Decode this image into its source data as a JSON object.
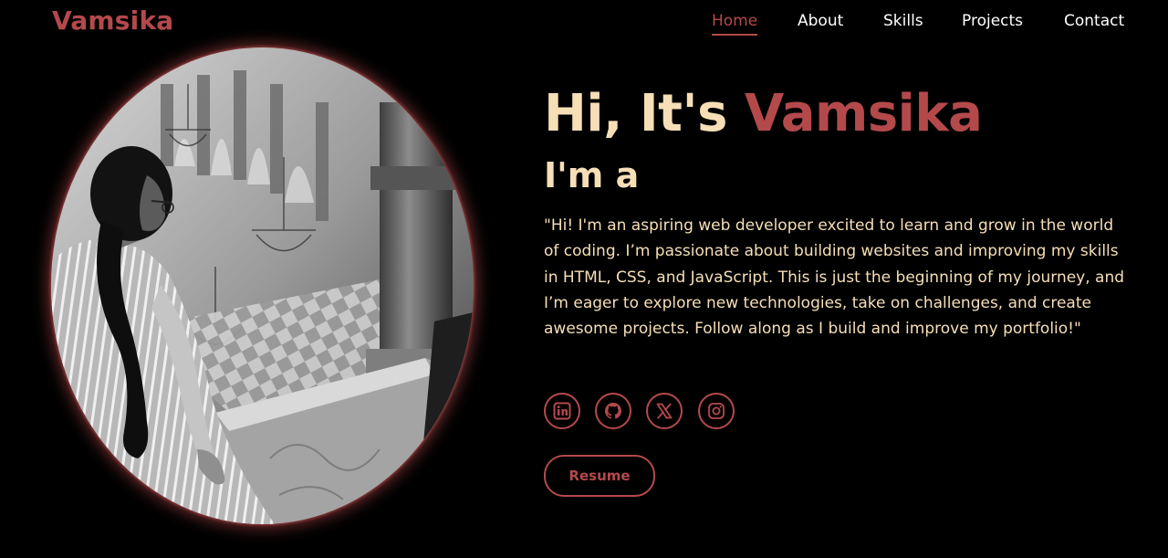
{
  "header": {
    "logo": "Vamsika",
    "nav": [
      {
        "label": "Home",
        "active": true
      },
      {
        "label": "About",
        "active": false
      },
      {
        "label": "Skills",
        "active": false
      },
      {
        "label": "Projects",
        "active": false
      },
      {
        "label": "Contact",
        "active": false
      }
    ]
  },
  "hero": {
    "greeting_prefix": "Hi, It's ",
    "greeting_name": "Vamsika",
    "subtitle": "I'm a",
    "bio": "\"Hi! I'm an aspiring web developer excited to learn and grow in the world of coding. I’m passionate about building websites and improving my skills in HTML, CSS, and JavaScript. This is just the beginning of my journey, and I’m eager to explore new technologies, take on challenges, and create awesome projects. Follow along as I build and improve my portfolio!\"",
    "socials": [
      {
        "icon": "linkedin-icon"
      },
      {
        "icon": "github-icon"
      },
      {
        "icon": "x-twitter-icon"
      },
      {
        "icon": "instagram-icon"
      }
    ],
    "resume_label": "Resume",
    "photo": {
      "kind": "profile-photo",
      "style": "black-and-white"
    }
  },
  "colors": {
    "background": "#000000",
    "accent": "#b4494b",
    "text_light": "#f6dfb7",
    "nav_text": "#ffffff"
  }
}
